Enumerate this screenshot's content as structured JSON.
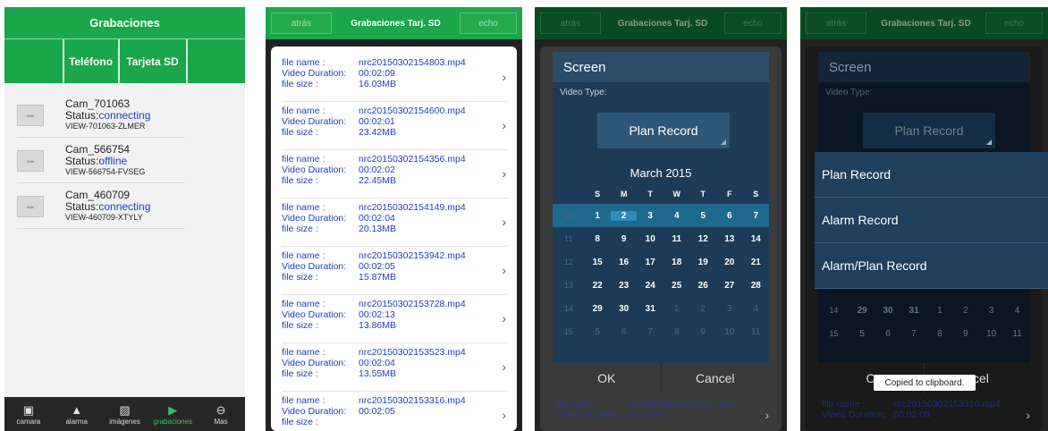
{
  "screen1": {
    "title": "Grabaciones",
    "tabs": [
      "Teléfono",
      "Tarjeta SD"
    ],
    "devices": [
      {
        "name": "Cam_701063",
        "status_label": "Status:",
        "status": "connecting",
        "id": "VIEW-701063-ZLMER"
      },
      {
        "name": "Cam_566754",
        "status_label": "Status:",
        "status": "offline",
        "id": "VIEW-566754-FVSEG"
      },
      {
        "name": "Cam_460709",
        "status_label": "Status:",
        "status": "connecting",
        "id": "VIEW-460709-XTYLY"
      }
    ],
    "bottom_nav": [
      {
        "label": "camara",
        "icon": "video-camera-icon"
      },
      {
        "label": "alarma",
        "icon": "bell-icon"
      },
      {
        "label": "imágenes",
        "icon": "image-icon"
      },
      {
        "label": "grabaciones",
        "icon": "play-icon",
        "active": true
      },
      {
        "label": "Mas",
        "icon": "more-icon"
      }
    ]
  },
  "header2": {
    "back": "atrás",
    "title": "Grabaciones Tarj. SD",
    "done": "echo"
  },
  "record_labels": {
    "file_name": "file name  :",
    "duration": "Video Duration:",
    "size": "file size  :"
  },
  "records": [
    {
      "file": "nrc20150302154803.mp4",
      "duration": "00:02:09",
      "size": "16.03MB"
    },
    {
      "file": "nrc20150302154600.mp4",
      "duration": "00:02:01",
      "size": "23.42MB"
    },
    {
      "file": "nrc20150302154356.mp4",
      "duration": "00:02:02",
      "size": "22.45MB"
    },
    {
      "file": "nrc20150302154149.mp4",
      "duration": "00:02:04",
      "size": "20.13MB"
    },
    {
      "file": "nrc20150302153942.mp4",
      "duration": "00:02:05",
      "size": "15.87MB"
    },
    {
      "file": "nrc20150302153728.mp4",
      "duration": "00:02:13",
      "size": "13.86MB"
    },
    {
      "file": "nrc20150302153523.mp4",
      "duration": "00:02:04",
      "size": "13.55MB"
    },
    {
      "file": "nrc20150302153316.mp4",
      "duration": "00:02:05",
      "size": ""
    }
  ],
  "dialog": {
    "title": "Screen",
    "video_type_label": "Video Type:",
    "selected_type": "Plan Record",
    "month": "March 2015",
    "weekdays": [
      "S",
      "M",
      "T",
      "W",
      "T",
      "F",
      "S"
    ],
    "weeks": [
      {
        "wk": "10",
        "days": [
          "1",
          "2",
          "3",
          "4",
          "5",
          "6",
          "7"
        ]
      },
      {
        "wk": "11",
        "days": [
          "8",
          "9",
          "10",
          "11",
          "12",
          "13",
          "14"
        ]
      },
      {
        "wk": "12",
        "days": [
          "15",
          "16",
          "17",
          "18",
          "19",
          "20",
          "21"
        ]
      },
      {
        "wk": "13",
        "days": [
          "22",
          "23",
          "24",
          "25",
          "26",
          "27",
          "28"
        ]
      },
      {
        "wk": "14",
        "days": [
          "29",
          "30",
          "31",
          "1",
          "2",
          "3",
          "4"
        ]
      },
      {
        "wk": "15",
        "days": [
          "5",
          "6",
          "7",
          "8",
          "9",
          "10",
          "11"
        ]
      }
    ],
    "ok": "OK",
    "cancel": "Cancel"
  },
  "dropdown_options": [
    "Plan Record",
    "Alarm Record",
    "Alarm/Plan Record"
  ],
  "toast": "Copied to clipboard.",
  "screen4_cancel_fragment": "ncel",
  "screen4_ok_fragment": "O",
  "colors": {
    "green": "#1aa64a",
    "link_blue": "#1e3fbf",
    "dialog_blue": "#1d3b56"
  }
}
